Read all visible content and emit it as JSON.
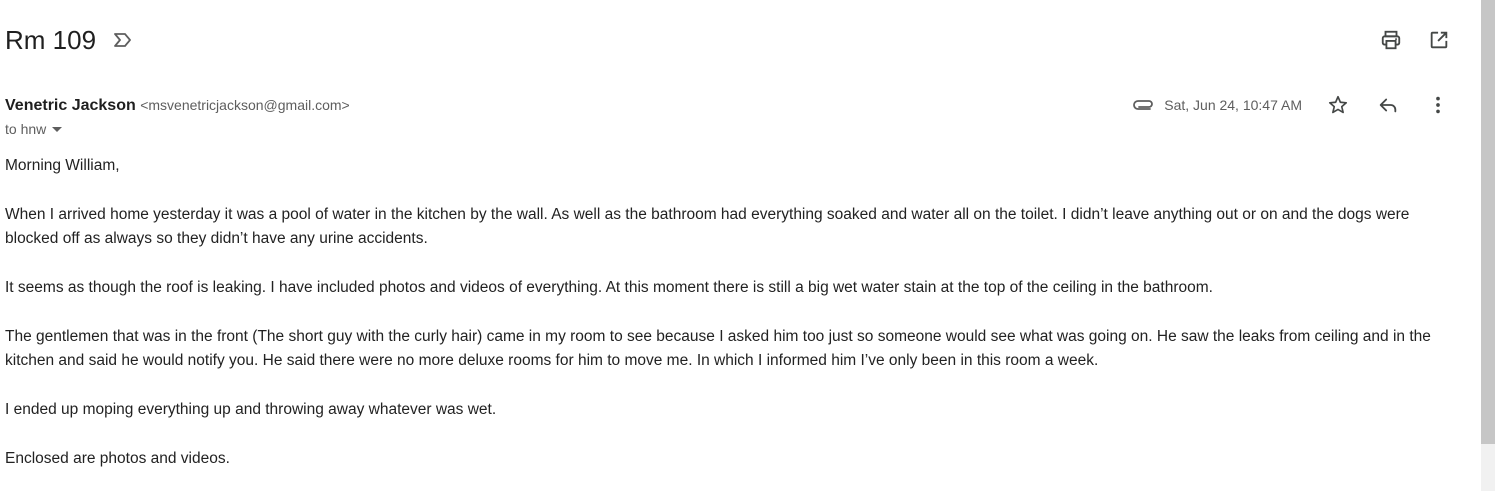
{
  "email": {
    "subject": "Rm 109",
    "sender_name": "Venetric Jackson",
    "sender_email": "<msvenetricjackson@gmail.com>",
    "recipient": "to hnw",
    "date": "Sat, Jun 24, 10:47 AM",
    "body": [
      "Morning William,",
      "When I arrived home yesterday it was a pool of water in the kitchen by the wall. As well as the bathroom had everything soaked and water all on the toilet. I didn’t leave anything out or on and the dogs were blocked off as always so they didn’t have any urine accidents.",
      "It seems as though the roof is leaking. I have included photos and videos of everything. At this moment there is still a big wet water stain at the top of the ceiling in the bathroom.",
      "The gentlemen that was in the front (The short guy with the curly hair) came in my room to see because I asked him too just so someone would see what was going on. He saw the leaks from ceiling and in the kitchen and said he would notify you. He said there were no more deluxe rooms for him to move me. In which I informed him I’ve only been in this room a week.",
      "I ended up moping everything up and throwing away whatever was wet.",
      "Enclosed are photos and videos."
    ]
  },
  "icons": {
    "label": "label-outline-icon",
    "print": "print-icon",
    "open_new_window": "open-in-new-icon",
    "attachment": "paperclip-icon",
    "star": "star-outline-icon",
    "reply": "reply-icon",
    "more": "more-vert-icon"
  },
  "colors": {
    "text_primary": "#1f1f1f",
    "text_secondary": "#5e5e5e",
    "icon": "#444746",
    "scrollbar_thumb": "#c6c6c6"
  }
}
